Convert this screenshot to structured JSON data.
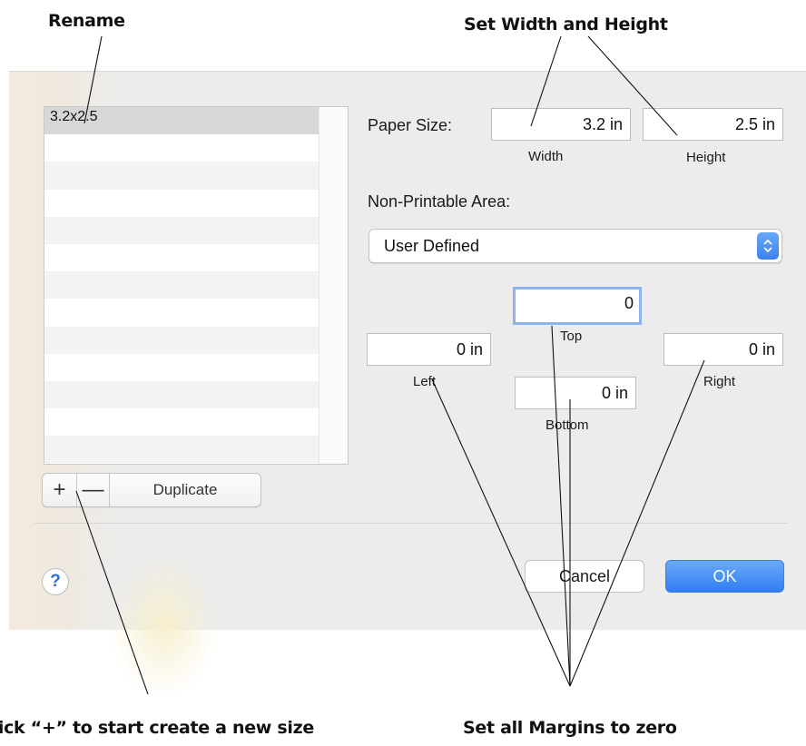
{
  "annotations": {
    "rename": "Rename",
    "set_width_height": "Set Width and Height",
    "click_plus": "Click “+” to start create a new size",
    "set_margins": "Set all Margins to zero"
  },
  "list": {
    "items": [
      "3.2x2.5"
    ],
    "empty_rows": 12
  },
  "list_controls": {
    "add_symbol": "+",
    "remove_symbol": "—",
    "duplicate_label": "Duplicate"
  },
  "paper_size": {
    "label": "Paper Size:",
    "width_value": "3.2 in",
    "width_label": "Width",
    "height_value": "2.5 in",
    "height_label": "Height"
  },
  "non_printable": {
    "label": "Non-Printable Area:",
    "selected": "User Defined",
    "arrow_icon": "up-down-chevron-icon"
  },
  "margins": {
    "top_value": "0",
    "top_label": "Top",
    "left_value": "0 in",
    "left_label": "Left",
    "right_value": "0 in",
    "right_label": "Right",
    "bottom_value": "0 in",
    "bottom_label": "Bottom"
  },
  "footer": {
    "help_symbol": "?",
    "cancel_label": "Cancel",
    "ok_label": "OK"
  },
  "colors": {
    "accent": "#3a82ef",
    "focus_ring": "#8db4ec"
  }
}
